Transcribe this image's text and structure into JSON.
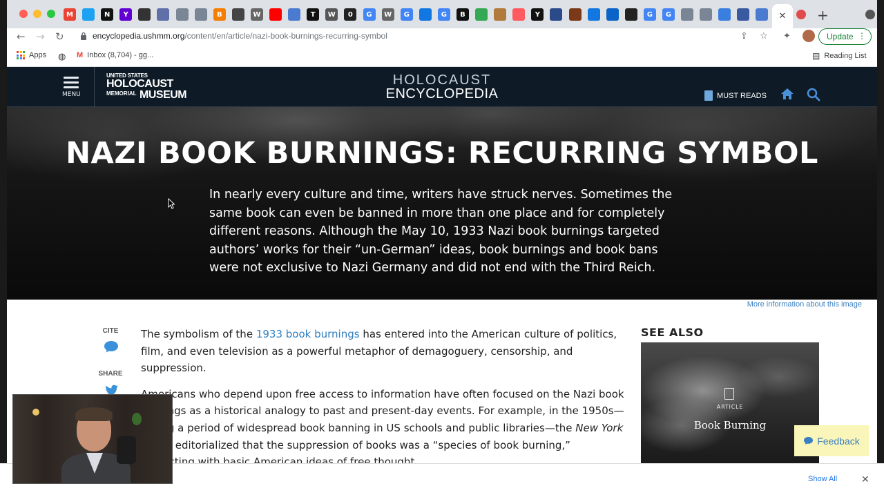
{
  "browser": {
    "url_host": "encyclopedia.ushmm.org",
    "url_path": "/content/en/article/nazi-book-burnings-recurring-symbol",
    "update_label": "Update",
    "bookmarks": [
      {
        "label": "Apps",
        "icon": "apps-grid-icon"
      },
      {
        "label": "",
        "icon": "globe-icon"
      },
      {
        "label": "Inbox (8,704) - gg...",
        "icon": "gmail-icon"
      }
    ],
    "reading_list_label": "Reading List",
    "tab_favicons": [
      {
        "icon": "gmail-icon",
        "color": "#ea4335",
        "glyph": "M"
      },
      {
        "icon": "twitter-icon",
        "color": "#1da1f2",
        "glyph": ""
      },
      {
        "icon": "notion-icon",
        "color": "#111111",
        "glyph": "N"
      },
      {
        "icon": "yahoo-icon",
        "color": "#6001d2",
        "glyph": "Y"
      },
      {
        "icon": "app-icon",
        "color": "#333333",
        "glyph": ""
      },
      {
        "icon": "chart-icon",
        "color": "#5f6fa8",
        "glyph": ""
      },
      {
        "icon": "chart-icon",
        "color": "#7a8595",
        "glyph": ""
      },
      {
        "icon": "chart-icon",
        "color": "#7a8595",
        "glyph": ""
      },
      {
        "icon": "blogger-icon",
        "color": "#f57d00",
        "glyph": "B"
      },
      {
        "icon": "app-icon",
        "color": "#444444",
        "glyph": ""
      },
      {
        "icon": "wikipedia-icon",
        "color": "#666666",
        "glyph": "W"
      },
      {
        "icon": "youtube-icon",
        "color": "#ff0000",
        "glyph": ""
      },
      {
        "icon": "nbc-icon",
        "color": "#4a7bd0",
        "glyph": ""
      },
      {
        "icon": "tv-icon",
        "color": "#111111",
        "glyph": "T"
      },
      {
        "icon": "wsj-icon",
        "color": "#555555",
        "glyph": "W"
      },
      {
        "icon": "app-icon",
        "color": "#222222",
        "glyph": "0"
      },
      {
        "icon": "google-icon",
        "color": "#4285f4",
        "glyph": "G"
      },
      {
        "icon": "wikipedia-icon",
        "color": "#666666",
        "glyph": "W"
      },
      {
        "icon": "google-icon",
        "color": "#4285f4",
        "glyph": "G"
      },
      {
        "icon": "zillow-icon",
        "color": "#1277e1",
        "glyph": ""
      },
      {
        "icon": "google-icon",
        "color": "#4285f4",
        "glyph": "G"
      },
      {
        "icon": "bold-icon",
        "color": "#111111",
        "glyph": "B"
      },
      {
        "icon": "maps-icon",
        "color": "#34a853",
        "glyph": ""
      },
      {
        "icon": "chart-icon",
        "color": "#b07a3a",
        "glyph": ""
      },
      {
        "icon": "airbnb-icon",
        "color": "#ff5a5f",
        "glyph": ""
      },
      {
        "icon": "y-icon",
        "color": "#111111",
        "glyph": "Y"
      },
      {
        "icon": "news-icon",
        "color": "#2a4a8a",
        "glyph": ""
      },
      {
        "icon": "app-icon",
        "color": "#7a3a1a",
        "glyph": ""
      },
      {
        "icon": "zillow-icon",
        "color": "#1277e1",
        "glyph": ""
      },
      {
        "icon": "outlook-icon",
        "color": "#0a64c8",
        "glyph": ""
      },
      {
        "icon": "app-icon",
        "color": "#222222",
        "glyph": ""
      },
      {
        "icon": "google-icon",
        "color": "#4285f4",
        "glyph": "G"
      },
      {
        "icon": "google-icon",
        "color": "#4285f4",
        "glyph": "G"
      },
      {
        "icon": "chart-icon",
        "color": "#7a8595",
        "glyph": ""
      },
      {
        "icon": "chart-icon",
        "color": "#7a8595",
        "glyph": ""
      },
      {
        "icon": "app-icon",
        "color": "#3a7fe0",
        "glyph": ""
      },
      {
        "icon": "shield-icon",
        "color": "#3a5aa0",
        "glyph": ""
      },
      {
        "icon": "nbc-icon",
        "color": "#4a7bd0",
        "glyph": ""
      }
    ]
  },
  "site": {
    "menu_label": "MENU",
    "logo": {
      "line1": "UNITED STATES",
      "line2": "HOLOCAUST",
      "line3": "MEMORIAL",
      "line4": "MUSEUM"
    },
    "encyclopedia_line1": "HOLOCAUST",
    "encyclopedia_line2": "ENCYCLOPEDIA",
    "must_reads_label": "MUST READS",
    "hero_title": "NAZI BOOK BURNINGS: RECURRING SYMBOL",
    "hero_text": "In nearly every culture and time, writers have struck nerves. Sometimes the same book can even be banned in more than one place and for completely different reasons. Although the May 10, 1933 Nazi book burnings targeted authors’ works for their “un-German” ideas, book burnings and book bans were not exclusive to Nazi Germany and did not end with the Third Reich.",
    "image_info_link": "More information about this image",
    "cite_label": "CITE",
    "share_label": "SHARE",
    "article": {
      "p1_before": "The symbolism of the ",
      "p1_link": "1933 book burnings",
      "p1_after": " has entered into the American culture of politics, film, and even television as a powerful metaphor of demagoguery, censorship, and suppression.",
      "p2_a": "Americans who depend upon free access to information have often focused on the Nazi book burnings as a historical analogy to past and present-day events. For example, in the 1950s—during a period of widespread book banning in US schools and public libraries—the ",
      "p2_em": "New York Times",
      "p2_b": " editorialized that the suppression of books was a “species of book burning,” conflicting with basic American ideas of free thought."
    },
    "see_also_heading": "SEE ALSO",
    "see_also_card": {
      "type": "ARTICLE",
      "title": "Book Burning"
    },
    "feedback_label": "Feedback"
  },
  "downloads_bar": {
    "show_all_label": "Show All",
    "close_glyph": "✕"
  },
  "colors": {
    "header_bg": "#0e1b26",
    "link": "#2f7fc0",
    "feedback_bg": "#faf6b9"
  }
}
